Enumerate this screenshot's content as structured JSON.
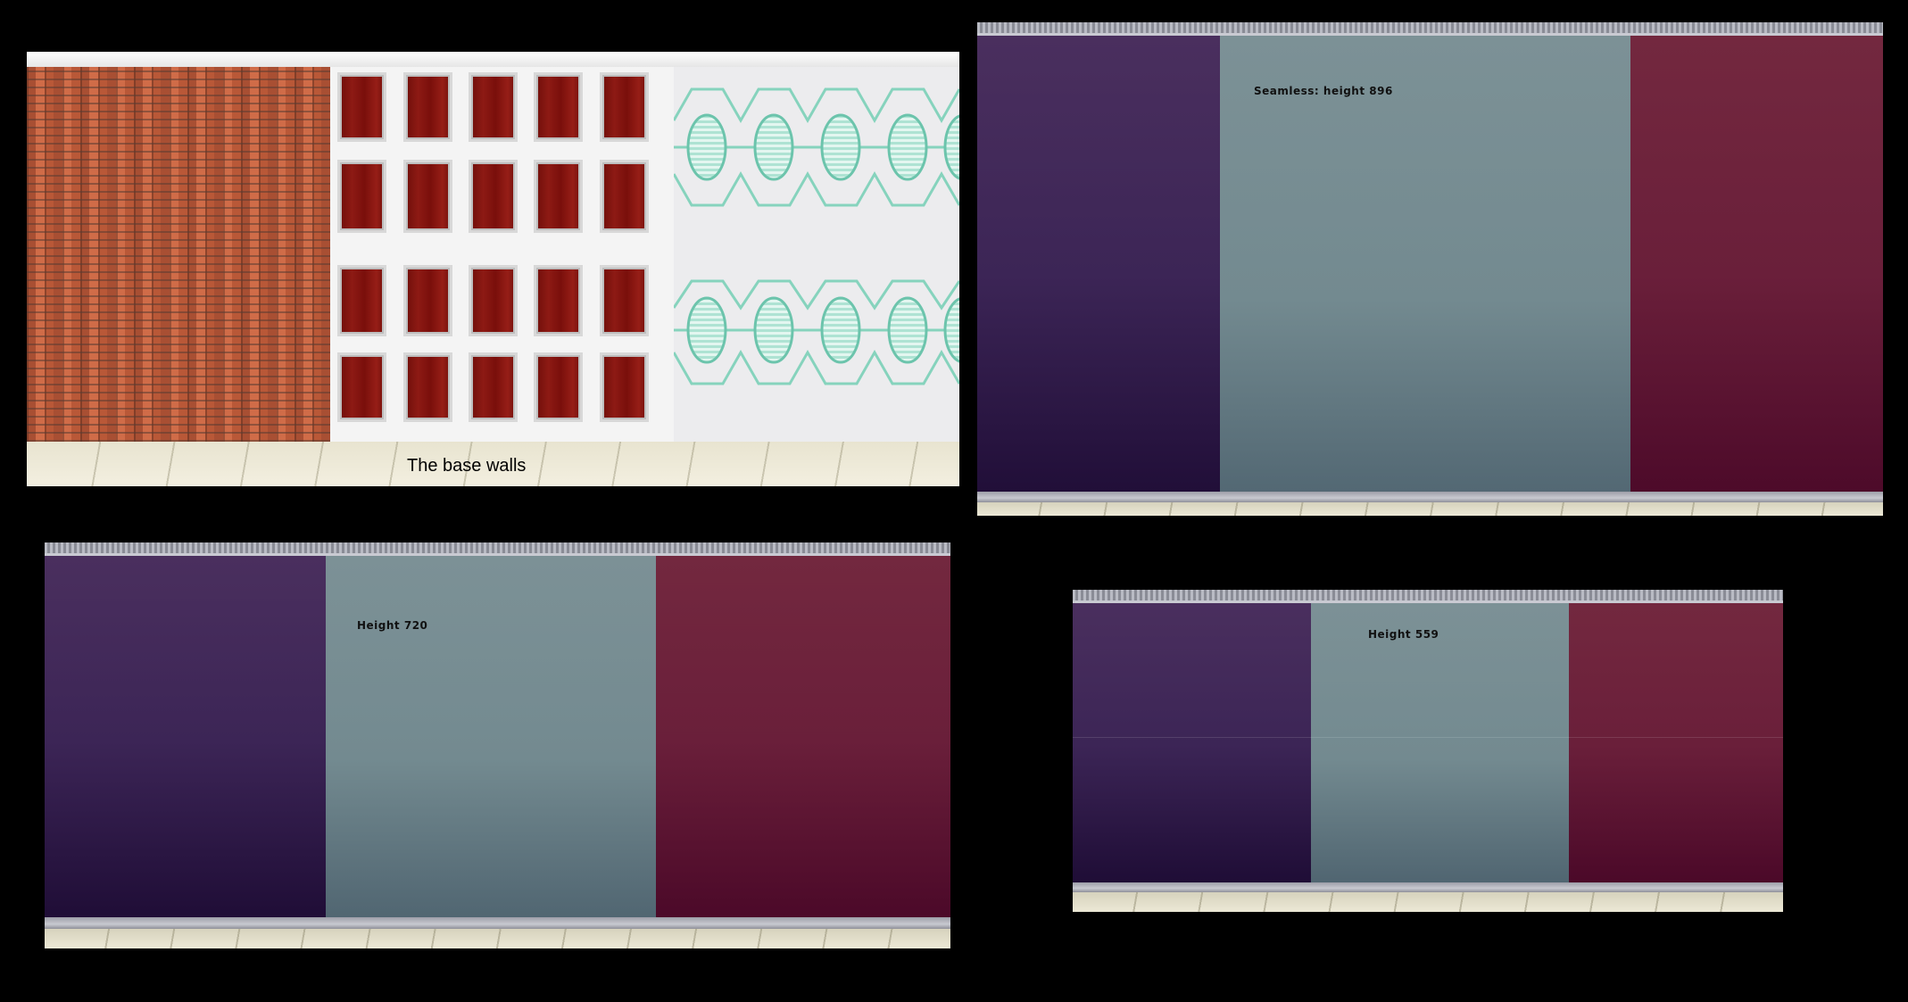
{
  "panels": {
    "base": {
      "caption": "The base walls"
    },
    "seamless_896": {
      "label": "Seamless: height 896"
    },
    "height_720": {
      "label": "Height 720"
    },
    "height_559": {
      "label": "Height 559"
    }
  },
  "colors": {
    "background": "#000000",
    "brick": "#c8643e",
    "wood_panel": "#8d1a14",
    "lattice_accent": "#7fcfb9",
    "purple_wall": "#3c2556",
    "slate_wall": "#738a90",
    "wine_wall": "#6a1f3a"
  }
}
